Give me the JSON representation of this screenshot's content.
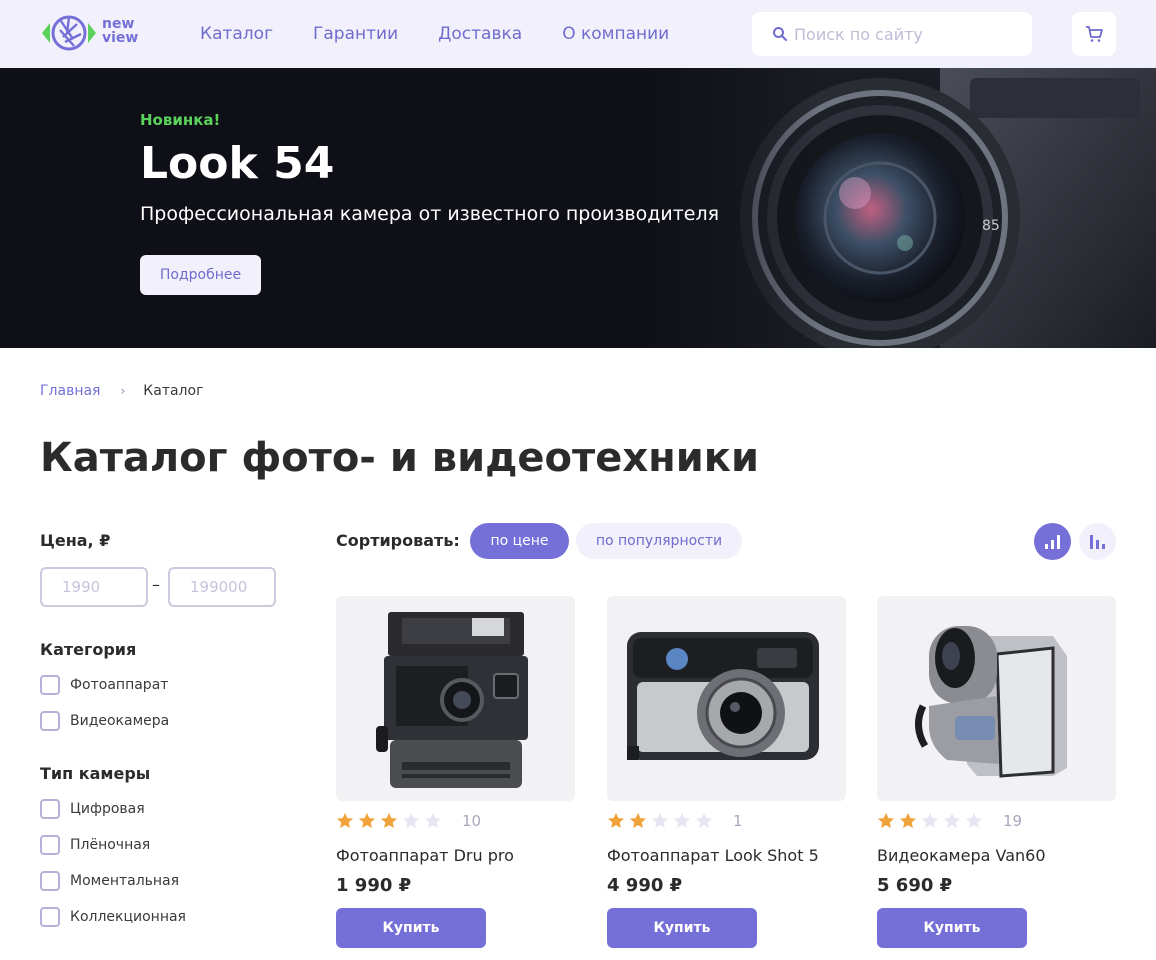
{
  "header": {
    "logo_text_top": "new",
    "logo_text_bottom": "view",
    "nav": [
      "Каталог",
      "Гарантии",
      "Доставка",
      "О компании"
    ],
    "search_placeholder": "Поиск по сайту"
  },
  "hero": {
    "badge": "Новинка!",
    "title": "Look 54",
    "subtitle": "Профессиональная камера от известного производителя",
    "button": "Подробнее",
    "lens_marking": "85"
  },
  "breadcrumbs": {
    "home": "Главная",
    "separator": "›",
    "current": "Каталог"
  },
  "page_title": "Каталог фото- и видеотехники",
  "filters": {
    "price_heading": "Цена, ₽",
    "price_min_placeholder": "1990",
    "price_max_placeholder": "199000",
    "price_dash": "–",
    "category_heading": "Категория",
    "categories": [
      "Фотоаппарат",
      "Видеокамера"
    ],
    "type_heading": "Тип камеры",
    "types": [
      "Цифровая",
      "Плёночная",
      "Моментальная",
      "Коллекционная"
    ]
  },
  "sort": {
    "label": "Сортировать:",
    "options": [
      "по цене",
      "по популярности"
    ],
    "active_option": "по цене",
    "direction_icons": [
      "sort-ascending-icon",
      "sort-descending-icon"
    ]
  },
  "products": [
    {
      "name": "Фотоаппарат Dru pro",
      "price": "1 990 ₽",
      "rating": 3,
      "reviews": "10",
      "buy": "Купить",
      "image": "polaroid-camera"
    },
    {
      "name": "Фотоаппарат Look Shot 5",
      "price": "4 990 ₽",
      "rating": 2,
      "reviews": "1",
      "buy": "Купить",
      "image": "compact-film-camera"
    },
    {
      "name": "Видеокамера Van60",
      "price": "5 690 ₽",
      "rating": 2,
      "reviews": "19",
      "buy": "Купить",
      "image": "camcorder"
    }
  ],
  "colors": {
    "accent": "#7470d8",
    "accent_light": "#f2f1fb",
    "badge_green": "#5bd25b",
    "star_filled": "#f0a23b",
    "star_empty": "#e6e5f4",
    "hero_bg": "#0e0f17"
  }
}
